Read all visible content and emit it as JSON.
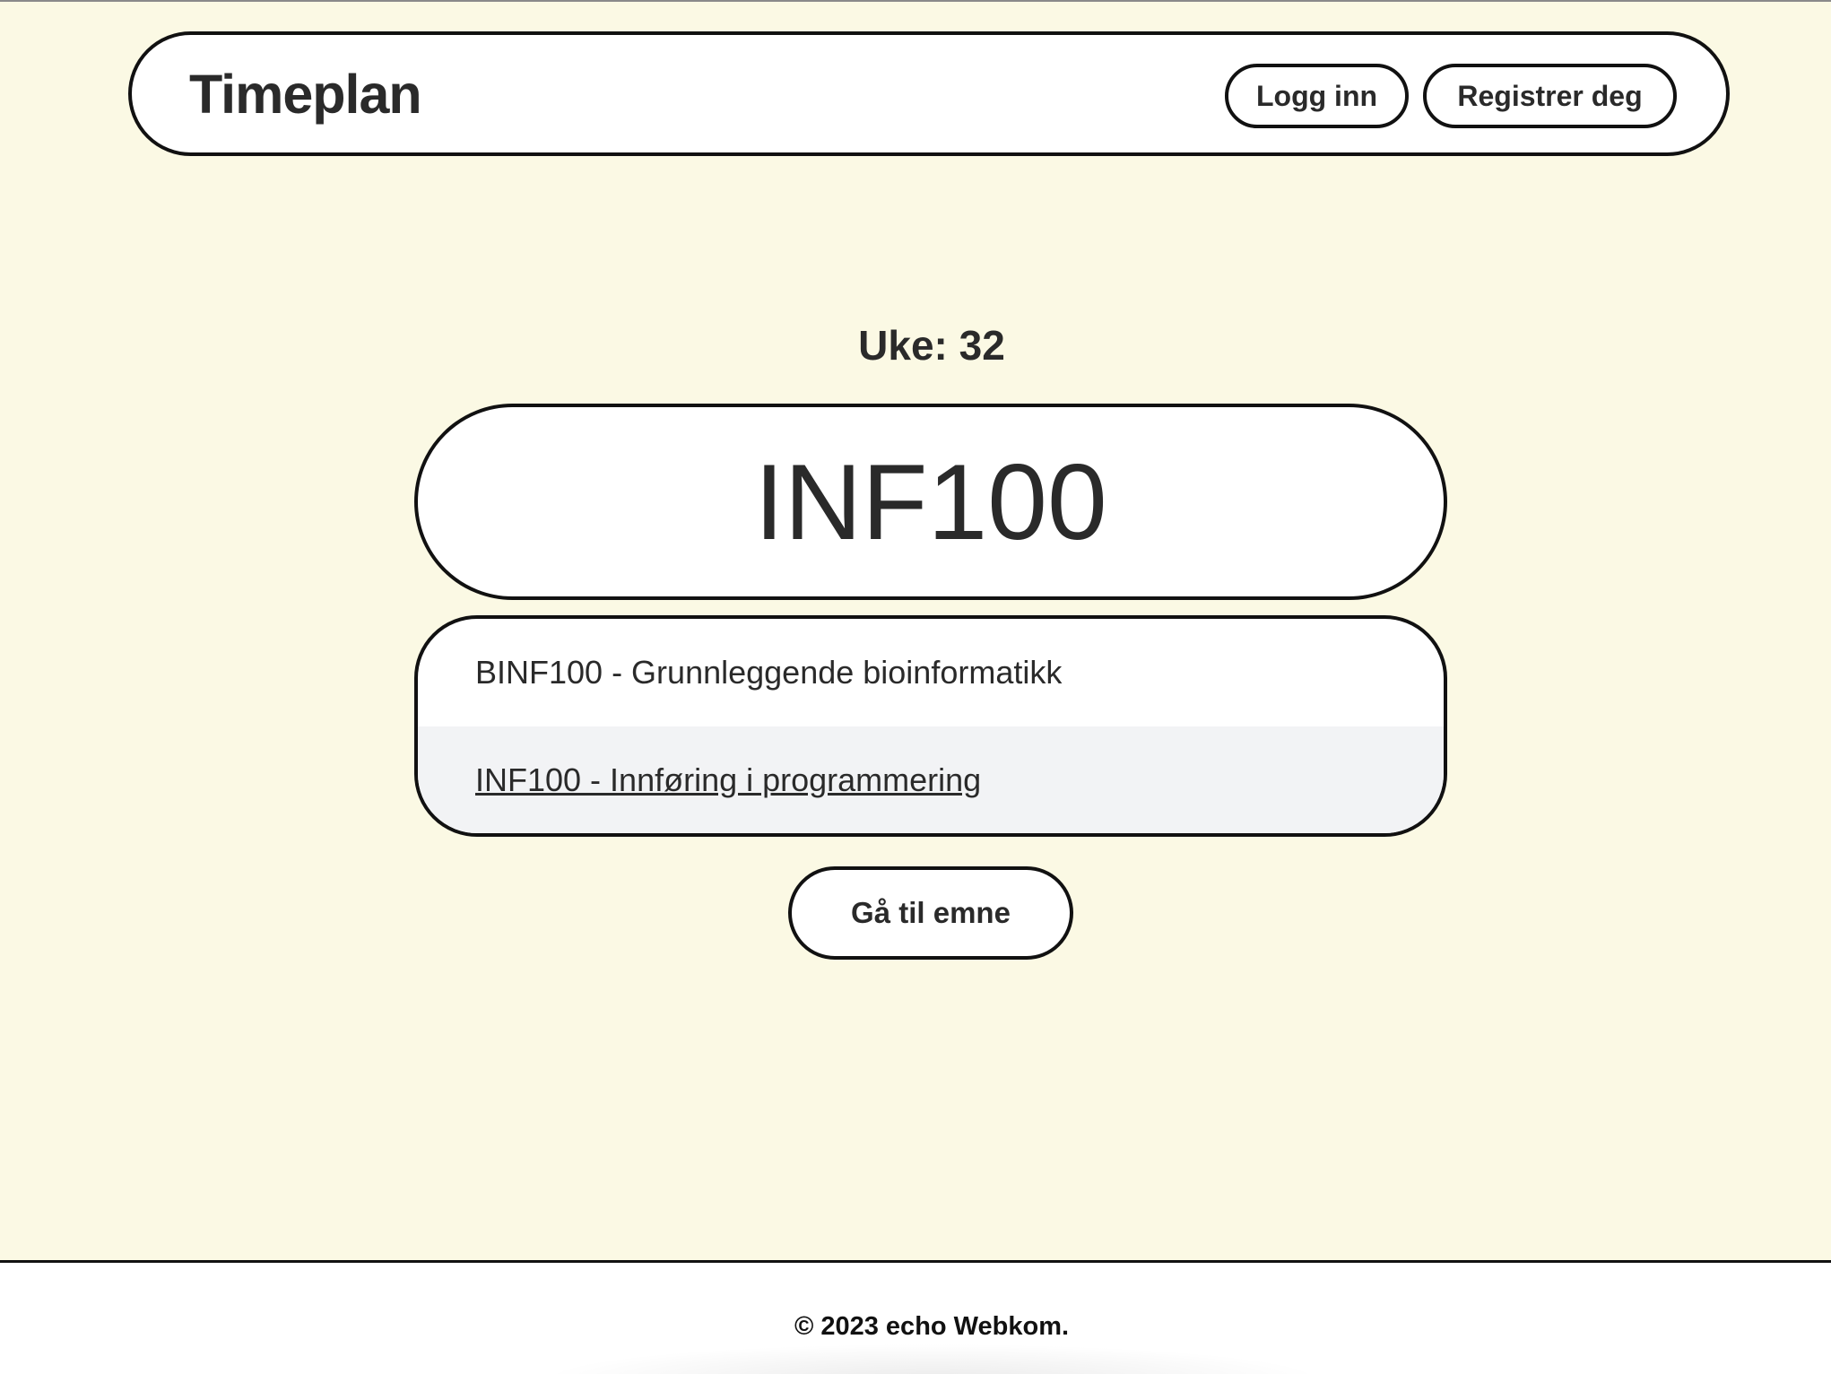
{
  "header": {
    "brand": "Timeplan",
    "login_label": "Logg inn",
    "register_label": "Registrer deg"
  },
  "week": {
    "label": "Uke: 32"
  },
  "course_search": {
    "value": "INF100"
  },
  "suggestions": [
    {
      "label": "BINF100 - Grunnleggende bioinformatikk"
    },
    {
      "label": "INF100 - Innføring i programmering"
    }
  ],
  "go_button": {
    "label": "Gå til emne"
  },
  "footer": {
    "text": "© 2023 echo Webkom."
  },
  "colors": {
    "page_background": "#fbf9e4",
    "surface": "#ffffff",
    "border": "#111111",
    "text": "#2a2a2a",
    "hover_row": "#f2f3f5"
  }
}
